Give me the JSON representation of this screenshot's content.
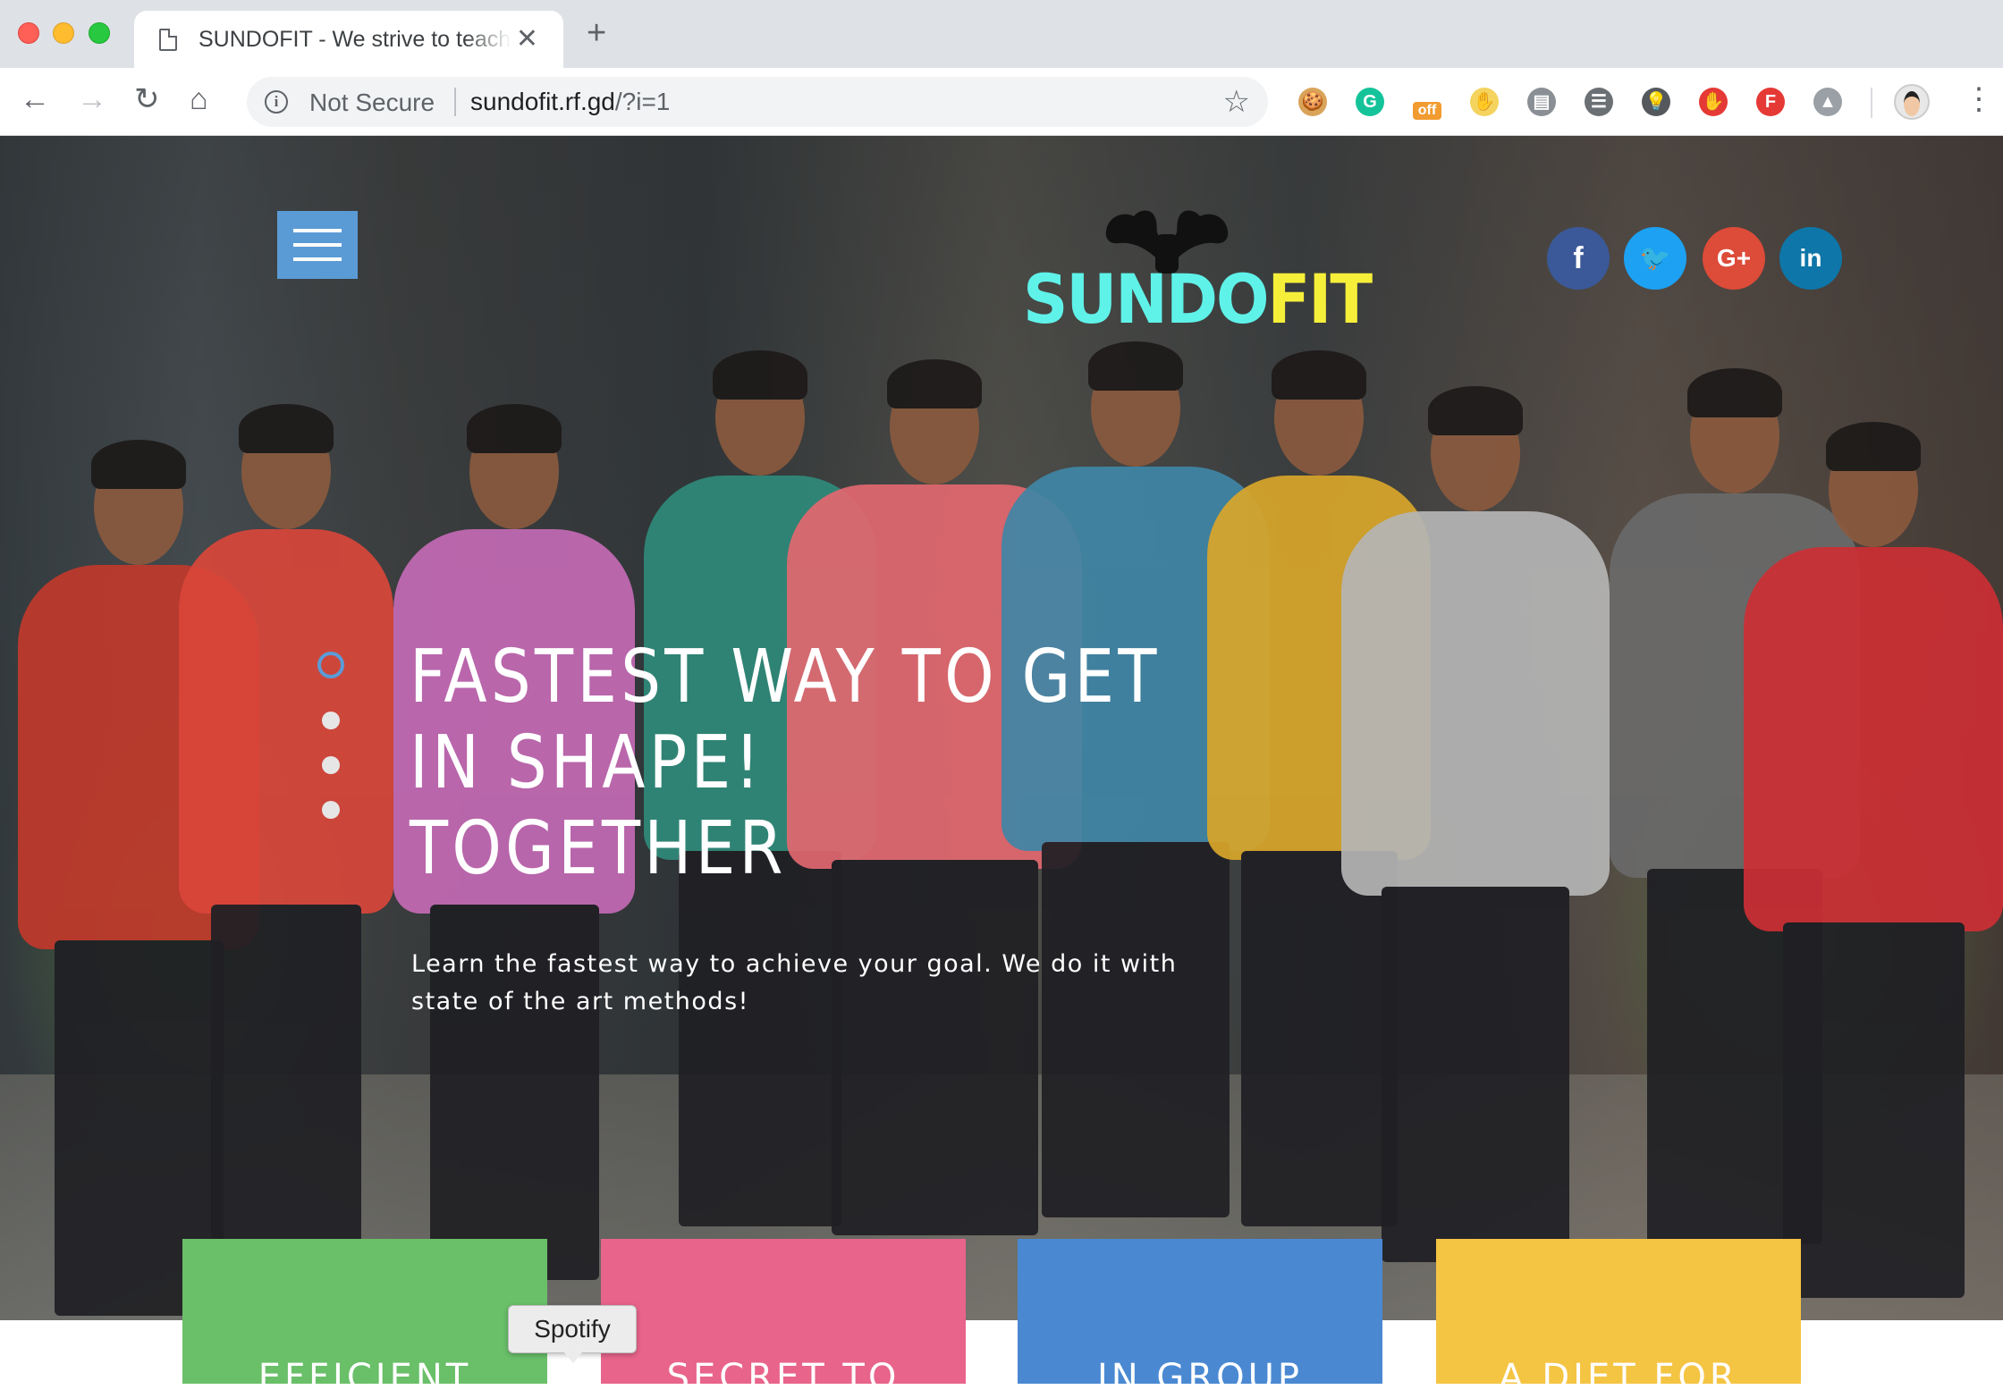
{
  "browser": {
    "tab_title": "SUNDOFIT - We strive to teach",
    "tab_close": "✕",
    "new_tab": "+",
    "nav": {
      "back": "←",
      "forward": "→",
      "reload": "↻",
      "home": "⌂"
    },
    "security_label": "Not Secure",
    "url_host": "sundofit.rf.gd",
    "url_path": "/?i=1",
    "bookmark": "☆",
    "extensions": [
      {
        "name": "cookie-extension-icon",
        "glyph": "🍪",
        "color": "#d9a45a"
      },
      {
        "name": "grammarly-icon",
        "glyph": "G",
        "color": "#15c39a"
      },
      {
        "name": "off-extension-icon",
        "glyph": "off",
        "color": "#f29b30"
      },
      {
        "name": "mouse-extension-icon",
        "glyph": "✋",
        "color": "#f4d35e"
      },
      {
        "name": "clipboard-extension-icon",
        "glyph": "▤",
        "color": "#8a8f95"
      },
      {
        "name": "tree-extension-icon",
        "glyph": "☰",
        "color": "#6b7075"
      },
      {
        "name": "lightbulb-extension-icon",
        "glyph": "💡",
        "color": "#55595e"
      },
      {
        "name": "stop-extension-icon",
        "glyph": "✋",
        "color": "#e53935"
      },
      {
        "name": "pdf-extension-icon",
        "glyph": "F",
        "color": "#e53935"
      },
      {
        "name": "drive-extension-icon",
        "glyph": "▲",
        "color": "#9aa0a6"
      }
    ],
    "menu": "⋮"
  },
  "hero": {
    "logo_text_part1": "SUNDO",
    "logo_text_part2": "FIT",
    "colors": {
      "logo_cyan": "#5ff2e9",
      "logo_yellow": "#f6ef3a",
      "accent_blue": "#5b9bd5"
    },
    "social": [
      {
        "name": "facebook-icon",
        "glyph": "f",
        "color": "#3b5998"
      },
      {
        "name": "twitter-icon",
        "glyph": "🐦",
        "color": "#1da1f2"
      },
      {
        "name": "google-plus-icon",
        "glyph": "G+",
        "color": "#dd4b39"
      },
      {
        "name": "linkedin-icon",
        "glyph": "in",
        "color": "#0e76a8"
      }
    ],
    "slider": {
      "count": 4,
      "active_index": 0
    },
    "headline_line1": "FASTEST WAY TO GET",
    "headline_line2": "IN SHAPE!",
    "headline_line3": "TOGETHER",
    "subtext": "Learn the fastest way to achieve your goal. We do it with state of the art methods!"
  },
  "cards": [
    {
      "title": "EFFICIENT",
      "color": "#6abf69"
    },
    {
      "title": "SECRET TO",
      "color": "#e8648b"
    },
    {
      "title": "IN GROUP",
      "color": "#4a89d2"
    },
    {
      "title": "A DIET FOR",
      "color": "#f4c443"
    }
  ],
  "tooltip": "Spotify"
}
